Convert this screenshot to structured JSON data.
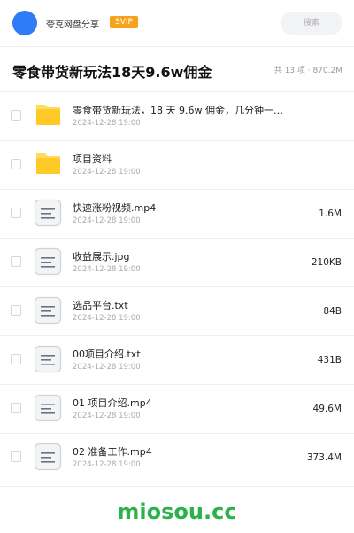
{
  "header": {
    "brand": "夸克网盘分享",
    "badge": "SVIP",
    "search_placeholder": "搜索"
  },
  "share": {
    "title": "零食带货新玩法18天9.6w佣金",
    "summary": "共 13 项 · 870.2M"
  },
  "files": [
    {
      "type": "folder",
      "name": "零食带货新玩法，18 天 9.6w 佣金，几分钟一…",
      "date": "2024-12-28 19:00",
      "size": ""
    },
    {
      "type": "folder",
      "name": "项目资料",
      "date": "2024-12-28 19:00",
      "size": ""
    },
    {
      "type": "file",
      "name": "快速涨粉视频.mp4",
      "date": "2024-12-28 19:00",
      "size": "1.6M"
    },
    {
      "type": "file",
      "name": "收益展示.jpg",
      "date": "2024-12-28 19:00",
      "size": "210KB"
    },
    {
      "type": "file",
      "name": "选品平台.txt",
      "date": "2024-12-28 19:00",
      "size": "84B"
    },
    {
      "type": "file",
      "name": "00项目介绍.txt",
      "date": "2024-12-28 19:00",
      "size": "431B"
    },
    {
      "type": "file",
      "name": "01 项目介绍.mp4",
      "date": "2024-12-28 19:00",
      "size": "49.6M"
    },
    {
      "type": "file",
      "name": "02 准备工作.mp4",
      "date": "2024-12-28 19:00",
      "size": "373.4M"
    }
  ],
  "footer": {
    "watermark": "miosou.cc"
  },
  "colors": {
    "accent_blue": "#2f7cf6",
    "svip_orange": "#f7a21c",
    "folder_yellow": "#ffc928",
    "watermark_green": "#2bb24c"
  }
}
